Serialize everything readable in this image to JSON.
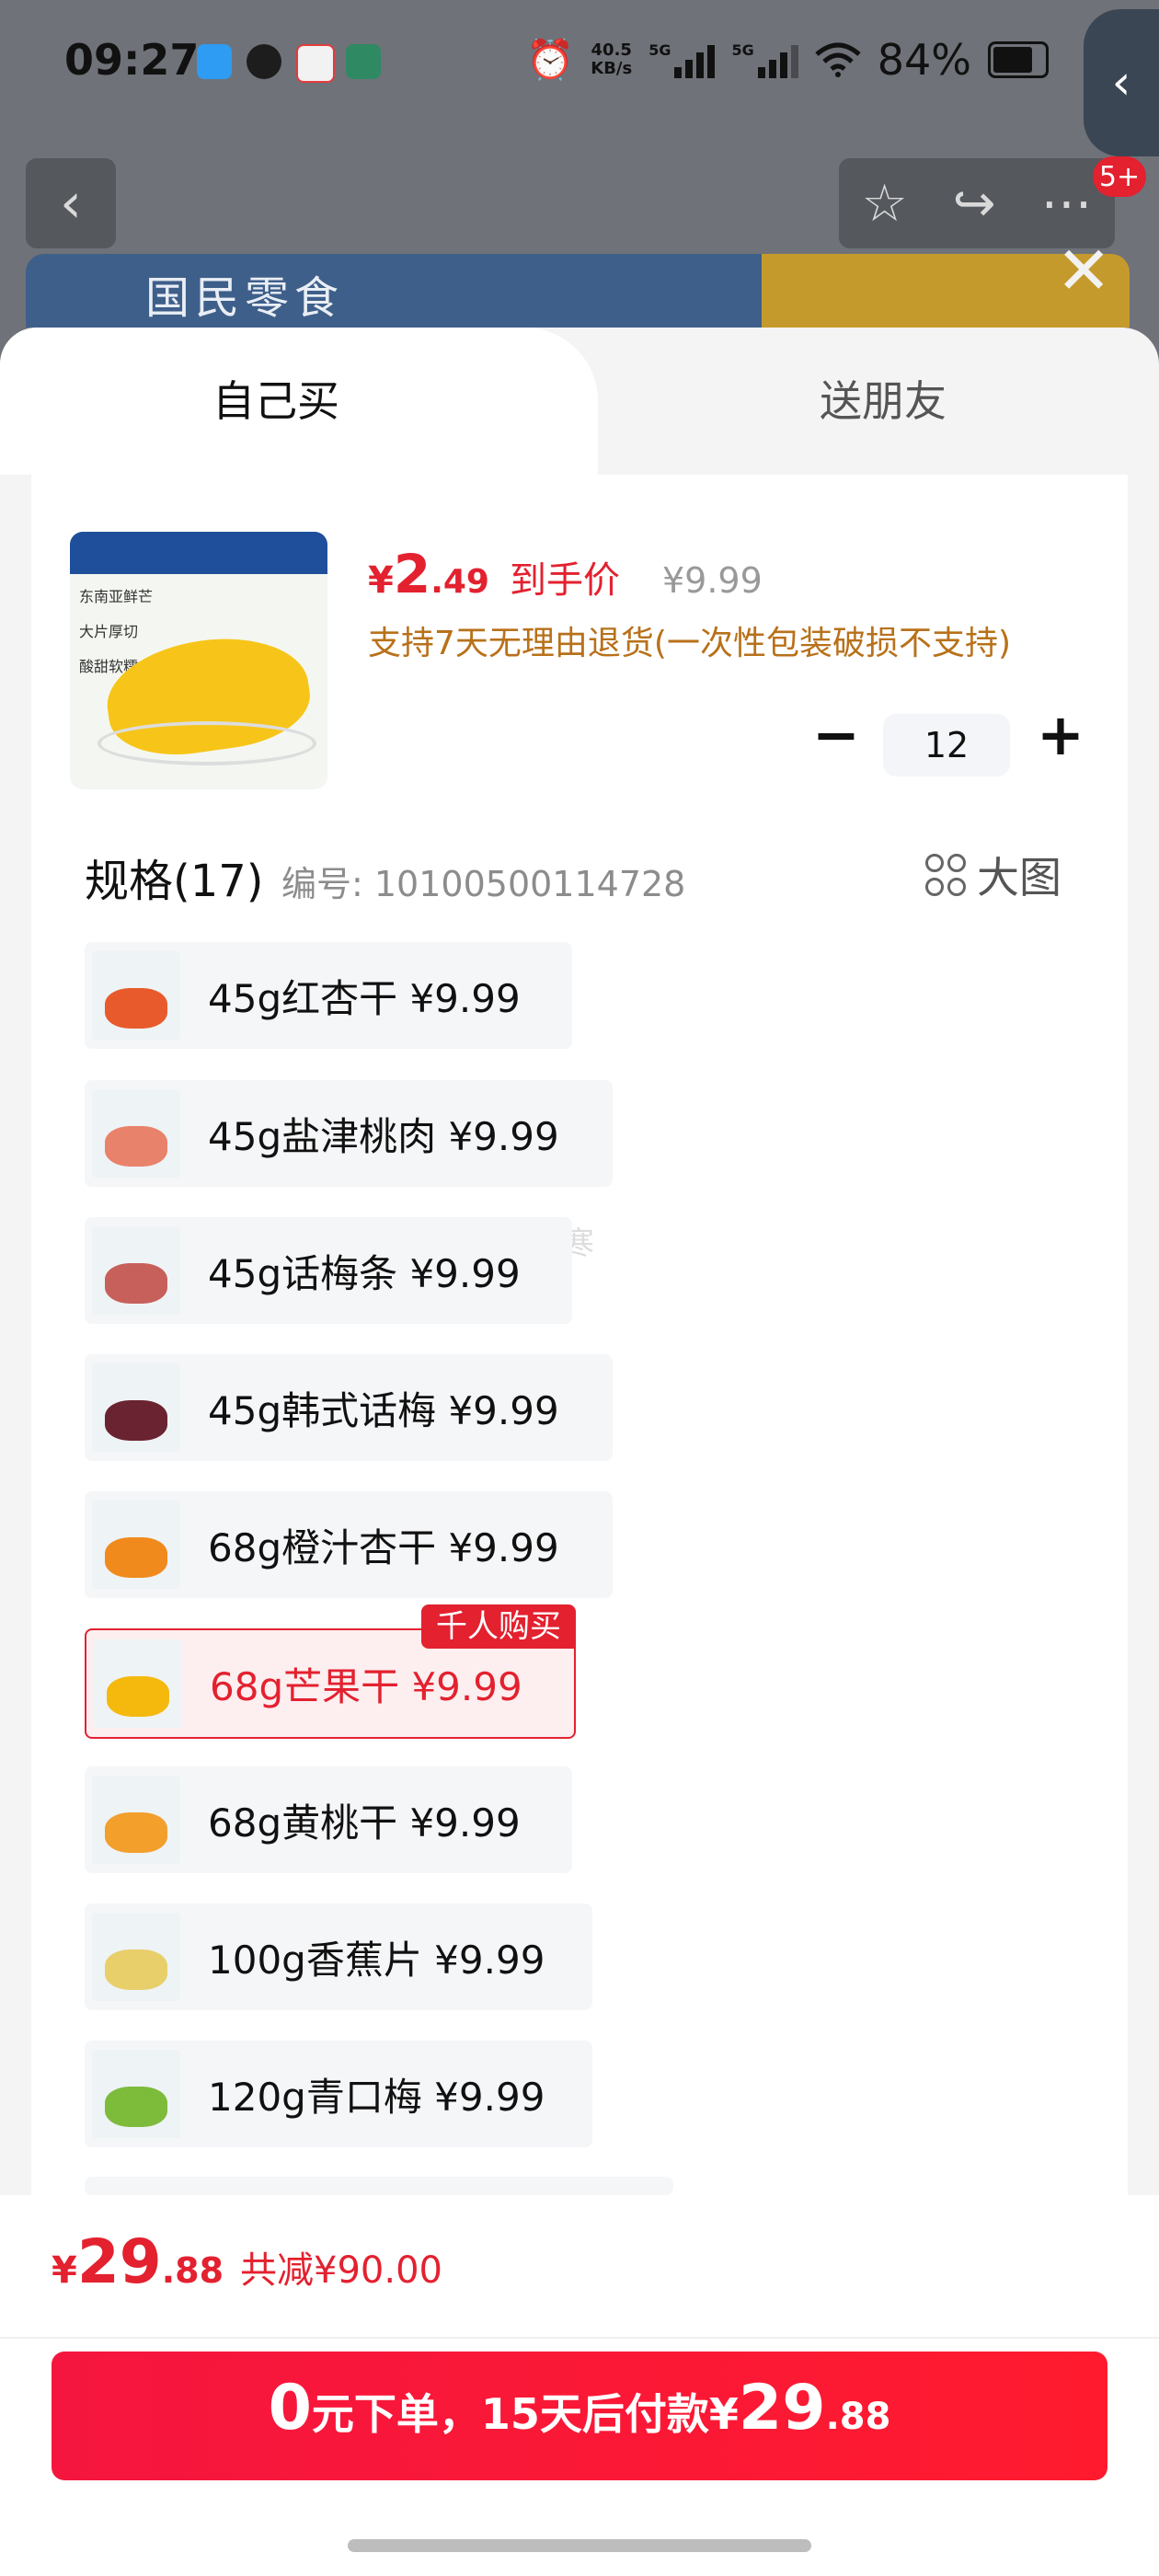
{
  "status_bar": {
    "time": "09:27",
    "net_speed_value": "40.5",
    "net_speed_unit": "KB/s",
    "sim1": "5G",
    "sim2": "5G",
    "battery": "84%"
  },
  "banner": {
    "text": "国民零食"
  },
  "tabs": {
    "self": "自己买",
    "friend": "送朋友"
  },
  "product": {
    "price_symbol": "¥",
    "price_int": "2",
    "price_dec": ".49",
    "price_label": "到手价",
    "original_price": "¥9.99",
    "return_policy": "支持7天无理由退货(一次性包装破损不支持)",
    "quantity": "12",
    "image_tags": [
      "东南亚鲜芒",
      "大片厚切",
      "酸甜软糯"
    ]
  },
  "specs": {
    "title": "规格(17)",
    "code": "编号: 10100500114728",
    "big_view": "大图",
    "hot_badge": "千人购买",
    "items": [
      {
        "label": "45g红杏干  ¥9.99",
        "color": "#e85a2b"
      },
      {
        "label": "45g盐津桃肉  ¥9.99",
        "color": "#e9826a"
      },
      {
        "label": "45g话梅条  ¥9.99",
        "color": "#c7605a"
      },
      {
        "label": "45g韩式话梅  ¥9.99",
        "color": "#6a2330"
      },
      {
        "label": "68g橙汁杏干  ¥9.99",
        "color": "#f08a1c"
      },
      {
        "label": "68g芒果干  ¥9.99",
        "color": "#f5b90e"
      },
      {
        "label": "68g黄桃干  ¥9.99",
        "color": "#f29f2c"
      },
      {
        "label": "100g香蕉片  ¥9.99",
        "color": "#e9cf6a"
      },
      {
        "label": "120g青口梅  ¥9.99",
        "color": "#7dbb3b"
      }
    ]
  },
  "watermark": "夜半深寒",
  "footer": {
    "total_symbol": "¥",
    "total_int": "29",
    "total_dec": ".88",
    "reduce": "共减¥90.00",
    "cta_zero": "0",
    "cta_mid": "元下单，15天后付款¥",
    "cta_int": "29",
    "cta_dec": ".88"
  },
  "colors": {
    "accent": "#e3212f",
    "policy": "#b8711a"
  }
}
